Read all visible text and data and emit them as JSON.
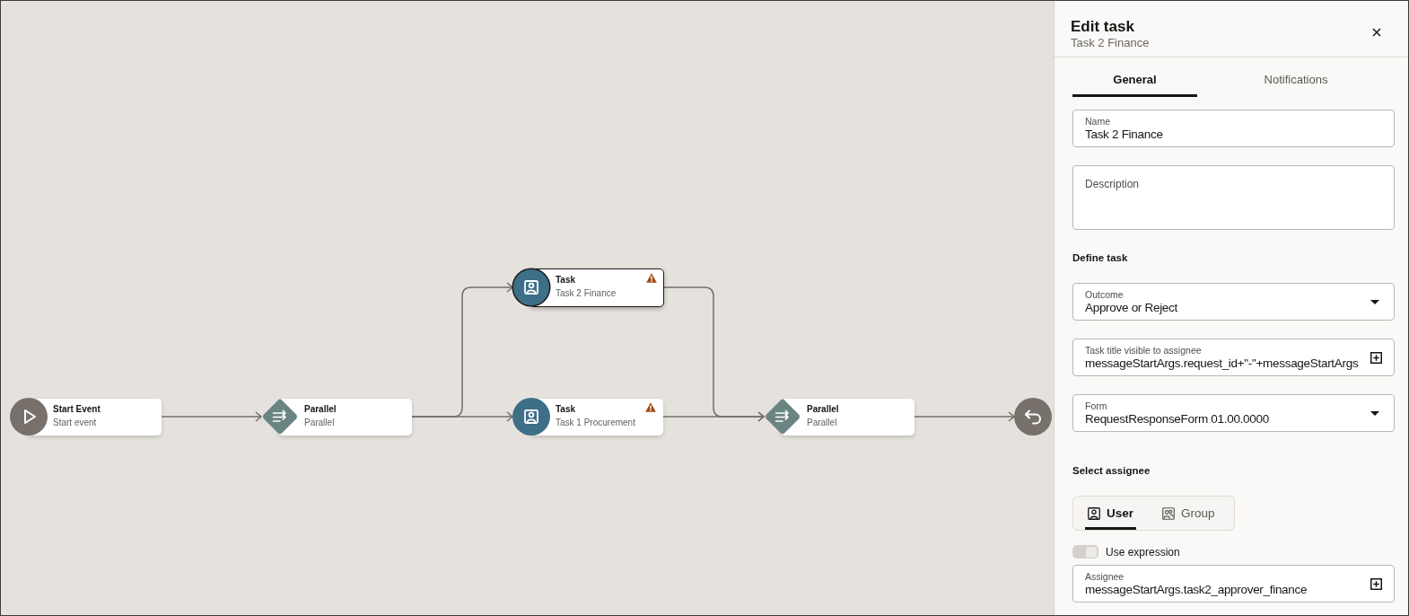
{
  "canvas": {
    "nodes": [
      {
        "kind": "start",
        "title": "Start Event",
        "subtitle": "Start event",
        "selected": false,
        "warning": false
      },
      {
        "kind": "gateway",
        "title": "Parallel",
        "subtitle": "Parallel",
        "selected": false,
        "warning": false
      },
      {
        "kind": "task",
        "title": "Task",
        "subtitle": "Task 2 Finance",
        "selected": true,
        "warning": true
      },
      {
        "kind": "task",
        "title": "Task",
        "subtitle": "Task 1 Procurement",
        "selected": false,
        "warning": true
      },
      {
        "kind": "gateway",
        "title": "Parallel",
        "subtitle": "Parallel",
        "selected": false,
        "warning": false
      },
      {
        "kind": "end",
        "selected": false,
        "warning": false
      }
    ]
  },
  "panel": {
    "title": "Edit task",
    "subtitle": "Task 2 Finance",
    "tabs": [
      {
        "label": "General",
        "selected": true
      },
      {
        "label": "Notifications",
        "selected": false
      }
    ],
    "fields": [
      {
        "kind": "text",
        "label": "Name",
        "value": "Task 2 Finance"
      },
      {
        "kind": "textarea",
        "label": "Description"
      }
    ],
    "define_task": {
      "heading": "Define task",
      "fields": [
        {
          "kind": "select",
          "label": "Outcome",
          "value": "Approve or Reject"
        },
        {
          "kind": "expression",
          "label": "Task title visible to assignee",
          "value": "messageStartArgs.request_id+\"-\"+messageStartArgs"
        },
        {
          "kind": "select",
          "label": "Form",
          "value": "RequestResponseForm 01.00.0000"
        }
      ]
    },
    "select_assignee": {
      "heading": "Select assignee",
      "options": [
        {
          "kind": "user",
          "label": "User",
          "selected": true
        },
        {
          "kind": "group",
          "label": "Group",
          "selected": false
        }
      ],
      "use_expression": {
        "label": "Use expression",
        "on": true,
        "disabled": true
      },
      "field": {
        "kind": "expression",
        "label": "Assignee",
        "value": "messageStartArgs.task2_approver_finance"
      }
    }
  }
}
